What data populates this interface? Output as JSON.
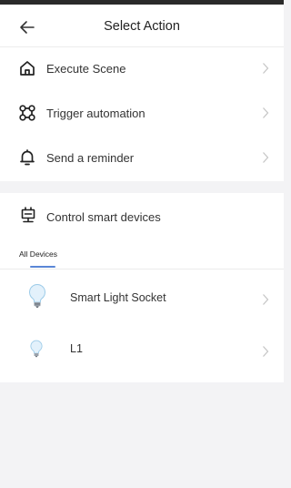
{
  "header": {
    "title": "Select Action",
    "back_icon": "back-arrow-icon"
  },
  "actions": [
    {
      "label": "Execute Scene",
      "icon": "home-icon"
    },
    {
      "label": "Trigger automation",
      "icon": "command-icon"
    },
    {
      "label": "Send a reminder",
      "icon": "bell-icon"
    }
  ],
  "control": {
    "label": "Control smart devices",
    "icon": "device-icon"
  },
  "tabs": [
    {
      "label": "All Devices",
      "selected": true
    }
  ],
  "devices": [
    {
      "label": "Smart Light Socket",
      "icon": "bulb-icon"
    },
    {
      "label": "L1",
      "icon": "bulb-icon"
    }
  ],
  "colors": {
    "accent": "#5a86d6",
    "background": "#f3f3f5",
    "chevron": "#c4c4c4"
  }
}
